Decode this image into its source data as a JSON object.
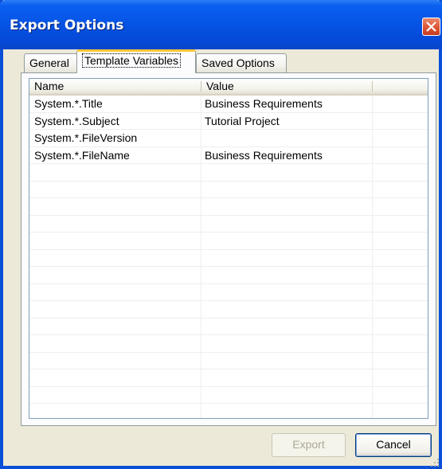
{
  "window": {
    "title": "Export Options"
  },
  "tabs": [
    {
      "label": "General"
    },
    {
      "label": "Template Variables"
    },
    {
      "label": "Saved Options"
    }
  ],
  "active_tab": "Template Variables",
  "table": {
    "columns": [
      "Name",
      "Value"
    ],
    "rows": [
      {
        "name": "System.*.Title",
        "value": "Business Requirements"
      },
      {
        "name": "System.*.Subject",
        "value": "Tutorial Project"
      },
      {
        "name": "System.*.FileVersion",
        "value": ""
      },
      {
        "name": "System.*.FileName",
        "value": "Business Requirements"
      }
    ]
  },
  "buttons": {
    "export": "Export",
    "cancel": "Cancel"
  },
  "colors": {
    "titlebar": "#0653e4",
    "close": "#e0583a",
    "active_tab_accent": "#ffc83c"
  }
}
